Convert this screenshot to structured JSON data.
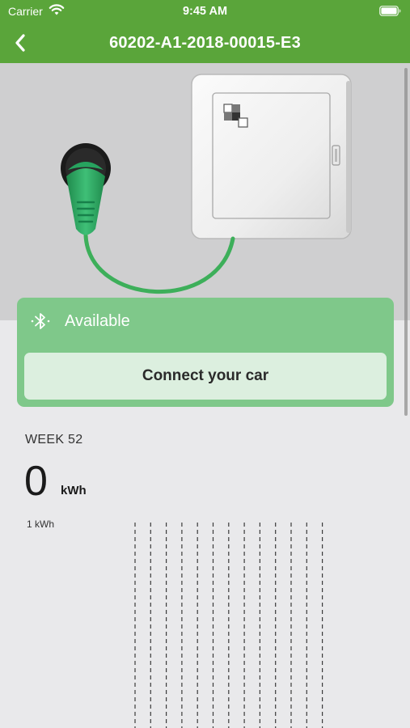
{
  "status_bar": {
    "carrier": "Carrier",
    "time": "9:45 AM",
    "icons": [
      "wifi-icon",
      "battery-icon"
    ]
  },
  "nav": {
    "back_icon": "chevron-left-icon",
    "title": "60202-A1-2018-00015-E3"
  },
  "charger": {
    "status_icon": "bluetooth-icon",
    "status_text": "Available",
    "connect_label": "Connect your car"
  },
  "stats": {
    "week_label": "WEEK 52",
    "energy_value": "0",
    "energy_unit": "kWh",
    "scale_label": "1 kWh"
  },
  "colors": {
    "brand_green": "#5aa53a",
    "card_green": "#7fc88a",
    "button_bg": "#dcefdf",
    "background": "#e9e9eb"
  },
  "chart_data": {
    "type": "bar",
    "categories": [],
    "series": [
      {
        "values": [
          0,
          0,
          0,
          0,
          0,
          0,
          0,
          0,
          0,
          0,
          0,
          0,
          0
        ]
      }
    ],
    "gridline_count": 13,
    "unit": "kWh"
  }
}
